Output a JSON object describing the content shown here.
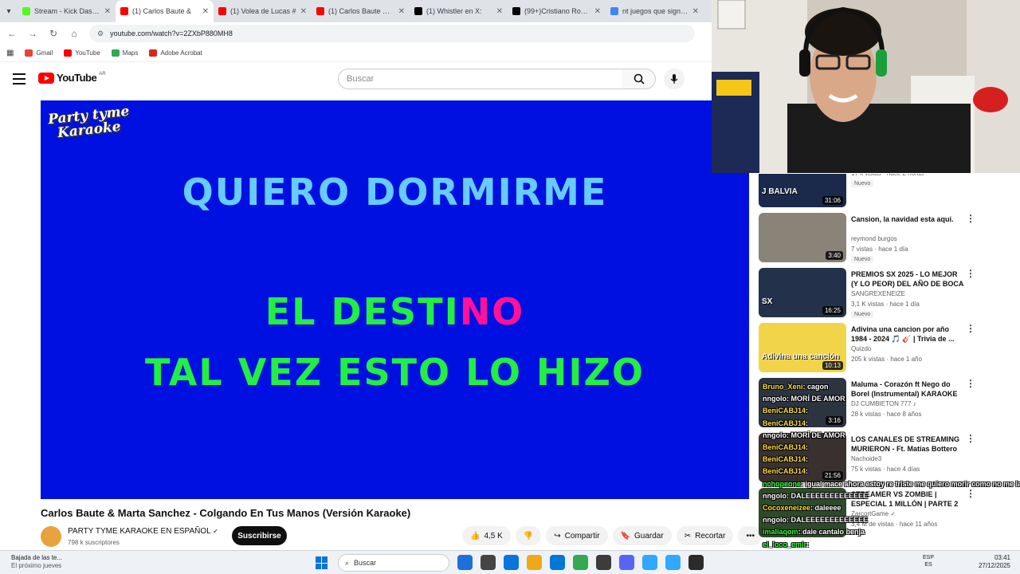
{
  "browser": {
    "tabs": [
      {
        "title": "Stream - Kick Dashbo",
        "color": "#53fc18",
        "active": false
      },
      {
        "title": "(1) Carlos Baute &",
        "color": "#ff0000",
        "active": true
      },
      {
        "title": "(1) Volea de Lucas #",
        "color": "#ff0000",
        "active": false
      },
      {
        "title": "(1) Carlos Baute & Ma",
        "color": "#ff0000",
        "active": false
      },
      {
        "title": "(1) Whistler en X:",
        "color": "#000000",
        "active": false
      },
      {
        "title": "(99+)Cristiano Ronal",
        "color": "#000000",
        "active": false
      },
      {
        "title": "nt juegos que signific",
        "color": "#4285f4",
        "active": false
      }
    ],
    "url": "youtube.com/watch?v=2ZXbP880MH8",
    "bookmarks": [
      {
        "label": "Gmail",
        "color": "#ea4335"
      },
      {
        "label": "YouTube",
        "color": "#ff0000"
      },
      {
        "label": "Maps",
        "color": "#34a853"
      },
      {
        "label": "Adobe Acrobat",
        "color": "#d9251c"
      }
    ]
  },
  "youtube": {
    "logo_text": "YouTube",
    "region": "AR",
    "search_placeholder": "Buscar"
  },
  "video": {
    "brand_line1": "Party tyme",
    "brand_line2": "Karaoke",
    "lyric_line1": "QUIERO DORMIRME",
    "lyric_line2_sung": "EL DESTI",
    "lyric_line2_rest": "NO",
    "lyric_line3": "TAL VEZ ESTO LO HIZO",
    "title": "Carlos Baute & Marta Sanchez - Colgando En Tus Manos (Versión Karaoke)",
    "channel": "PARTY TYME KARAOKE EN ESPAÑOL",
    "subscribers": "798 k suscriptores",
    "subscribe_label": "Suscribirse",
    "likes": "4,5 K",
    "share_label": "Compartir",
    "save_label": "Guardar",
    "clip_label": "Recortar"
  },
  "recommendations": [
    {
      "title": "",
      "channel": "Davoo Xeneize Plus ✓",
      "meta": "17 k vistas · hace 2 horas",
      "badge": "Nuevo",
      "duration": "31:06",
      "thumb": "#1b2a4a",
      "thumb_text": "J BALVIA"
    },
    {
      "title": "Cansion, la navidad esta aqui.",
      "channel": "reymond burgos",
      "meta": "7 vistas · hace 1 día",
      "badge": "Nuevo",
      "duration": "3:40",
      "thumb": "#8a8478",
      "thumb_text": ""
    },
    {
      "title": "PREMIOS SX 2025 - LO MEJOR (Y LO PEOR) DEL AÑO DE BOCA",
      "channel": "SANGREXENEIZE",
      "meta": "3,1 K vistas · hace 1 día",
      "badge": "Nuevo",
      "duration": "16:25",
      "thumb": "#23324a",
      "thumb_text": "SX"
    },
    {
      "title": "Adivina una cancion por año 1984 - 2024 🎵 🎸 | Trivia de ...",
      "channel": "Quizdo",
      "meta": "205 k vistas · hace 1 año",
      "badge": "",
      "duration": "10:13",
      "thumb": "#f2d44a",
      "thumb_text": "Adivina una canción"
    },
    {
      "title": "Maluma - Corazón ft Nego do Borel (Instrumental) KARAOKE",
      "channel": "DJ CUMBIETON 777 ♪",
      "meta": "28 k vistas · hace 8 años",
      "badge": "",
      "duration": "3:16",
      "thumb": "#2c3440",
      "thumb_text": ""
    },
    {
      "title": "LOS CANALES DE STREAMING MURIERON - Ft. Matías Bottero",
      "channel": "Nachoide3",
      "meta": "75 k vistas · hace 4 días",
      "badge": "",
      "duration": "21:56",
      "thumb": "#3a3030",
      "thumb_text": ""
    },
    {
      "title": "STREAMER VS ZOMBIE | ESPECIAL 1 MILLÓN | PARTE 2",
      "channel": "ZarcortGame ✓",
      "meta": "3,4 M de vistas · hace 11 años",
      "badge": "",
      "duration": "",
      "thumb": "#2f4a2a",
      "thumb_text": ""
    }
  ],
  "chat": [
    {
      "user": "Bruno_Xeni",
      "text": ": cagon",
      "ucolor": "y"
    },
    {
      "user": "nngolo",
      "text": ": MORÍ DE AMOR",
      "ucolor": "w"
    },
    {
      "user": "BeniCABJ14",
      "text": ":",
      "ucolor": "y"
    },
    {
      "user": "BeniCABJ14",
      "text": ":",
      "ucolor": "y"
    },
    {
      "user": "nngolo",
      "text": ": MORÍ DE AMOR",
      "ucolor": "w"
    },
    {
      "user": "BeniCABJ14",
      "text": ":",
      "ucolor": "y"
    },
    {
      "user": "BeniCABJ14",
      "text": ":",
      "ucolor": "y"
    },
    {
      "user": "BeniCABJ14",
      "text": ":",
      "ucolor": "y"
    },
    {
      "user": "nchopeone",
      "text": ": igual mace ahora estoy re triste me quiero morir como no me la dejaron y la espantaron incomandola",
      "ucolor": "g"
    },
    {
      "user": "nngolo",
      "text": ": DALEEEEEEEEEEEEE",
      "ucolor": "w"
    },
    {
      "user": "Cocoxeneizee",
      "text": ": daleeee",
      "ucolor": "y"
    },
    {
      "user": "nngolo",
      "text": ": DALEEEEEEEEEEEEE",
      "ucolor": "w"
    },
    {
      "user": "imaliaqom",
      "text": ": dale cantalo benja",
      "ucolor": "g"
    },
    {
      "user": "el_loco_emir",
      "text": ":",
      "ucolor": "g"
    },
    {
      "user": "joaco_agudo27",
      "text": ": DALE",
      "ucolor": "g"
    }
  ],
  "taskbar": {
    "weather_title": "Bajada de las te...",
    "weather_sub": "El próximo jueves",
    "search_placeholder": "Buscar",
    "lang1": "ESP",
    "lang2": "ES",
    "time": "03:41",
    "date": "27/12/2025",
    "apps": [
      "#1e6fd9",
      "#444444",
      "#0a74da",
      "#f0a818",
      "#0078d4",
      "#35a852",
      "#3c3c3c",
      "#5865f2",
      "#31a8ff",
      "#31a8ff",
      "#2b2b2b"
    ]
  }
}
